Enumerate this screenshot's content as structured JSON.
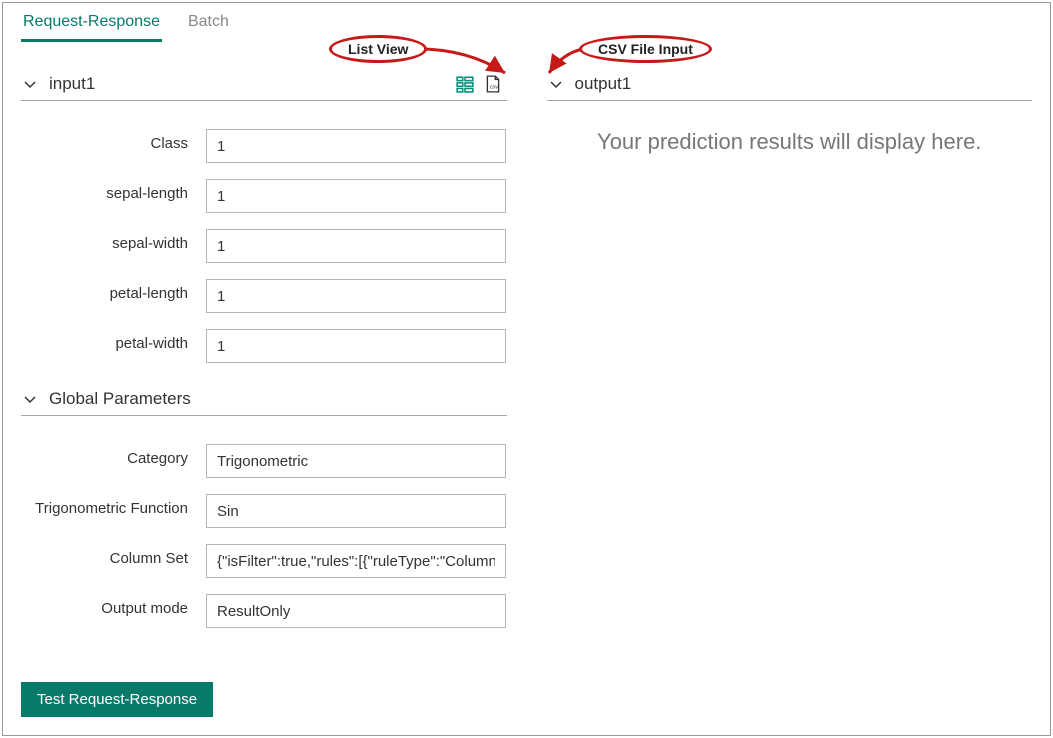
{
  "tabs": {
    "request_response": "Request-Response",
    "batch": "Batch"
  },
  "annotations": {
    "list_view": "List View",
    "csv_file_input": "CSV File Input"
  },
  "input_section": {
    "title": "input1",
    "fields": [
      {
        "label": "Class",
        "value": "1"
      },
      {
        "label": "sepal-length",
        "value": "1"
      },
      {
        "label": "sepal-width",
        "value": "1"
      },
      {
        "label": "petal-length",
        "value": "1"
      },
      {
        "label": "petal-width",
        "value": "1"
      }
    ]
  },
  "global_params": {
    "title": "Global Parameters",
    "fields": [
      {
        "label": "Category",
        "value": "Trigonometric"
      },
      {
        "label": "Trigonometric Function",
        "value": "Sin"
      },
      {
        "label": "Column Set",
        "value": "{\"isFilter\":true,\"rules\":[{\"ruleType\":\"ColumnTy"
      },
      {
        "label": "Output mode",
        "value": "ResultOnly"
      }
    ]
  },
  "output_section": {
    "title": "output1",
    "placeholder": "Your prediction results will display here."
  },
  "buttons": {
    "test": "Test Request-Response"
  }
}
